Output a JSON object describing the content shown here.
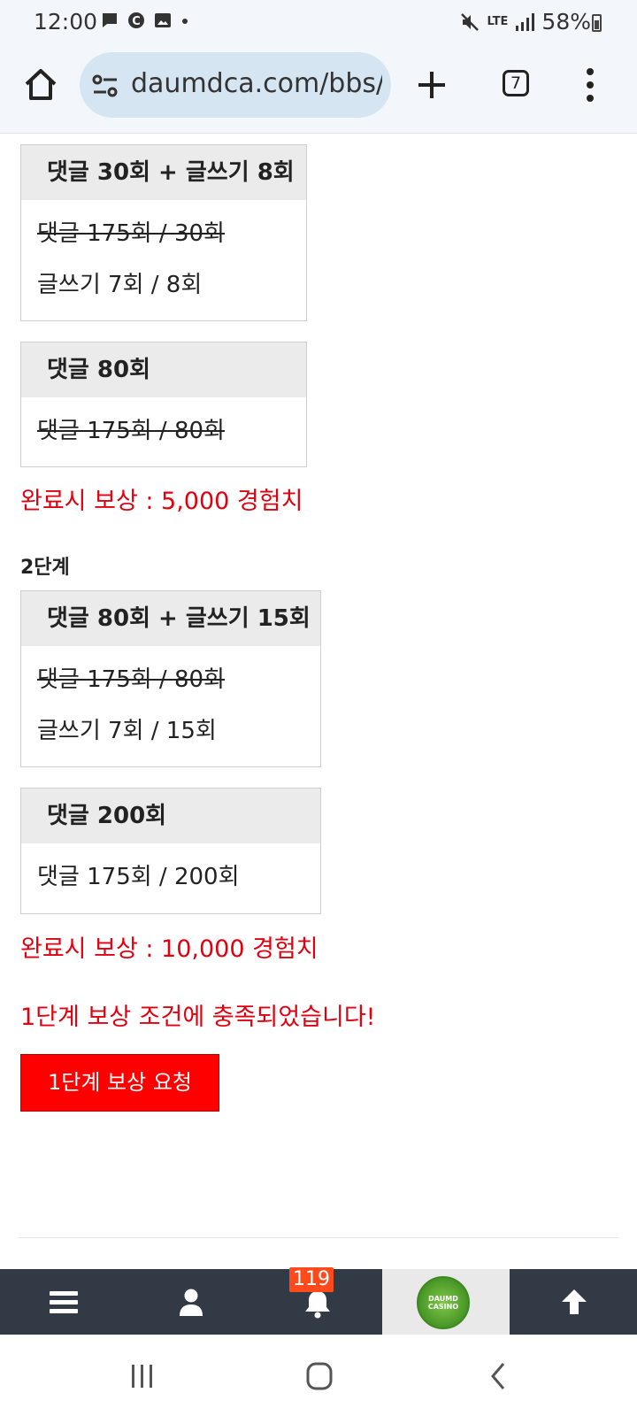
{
  "status_bar": {
    "time": "12:00",
    "network": "LTE",
    "battery": "58%"
  },
  "browser": {
    "url": "daumdca.com/bbs/p",
    "tab_count": "7"
  },
  "stage1": {
    "tasks": [
      {
        "title": "댓글 30회 + 글쓰기 8회",
        "lines": [
          {
            "text": "댓글 175회 / 30회",
            "done": true
          },
          {
            "text": "글쓰기 7회 / 8회",
            "done": false
          }
        ]
      },
      {
        "title": "댓글 80회",
        "lines": [
          {
            "text": "댓글 175회 / 80회",
            "done": true
          }
        ]
      }
    ],
    "reward": "완료시 보상 : 5,000 경험치"
  },
  "stage2": {
    "label": "2단계",
    "tasks": [
      {
        "title": "댓글 80회 + 글쓰기 15회",
        "lines": [
          {
            "text": "댓글 175회 / 80회",
            "done": true
          },
          {
            "text": "글쓰기 7회 / 15회",
            "done": false
          }
        ]
      },
      {
        "title": "댓글 200회",
        "lines": [
          {
            "text": "댓글 175회 / 200회",
            "done": false
          }
        ]
      }
    ],
    "reward": "완료시 보상 : 10,000 경험치"
  },
  "notice": "1단계 보상 조건에 충족되었습니다!",
  "request_button": "1단계 보상 요청",
  "bottom_nav": {
    "notification_count": "119",
    "logo_text": "DAUMD CASINO"
  },
  "colors": {
    "accent_red": "#e0000f",
    "button_red": "#ff0000",
    "nav_bg": "#323a45",
    "badge": "#ff4a1c"
  }
}
